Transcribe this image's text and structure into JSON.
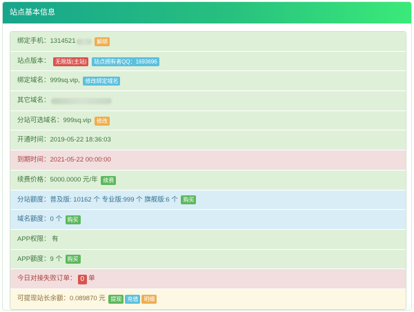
{
  "panel": {
    "title": "站点基本信息"
  },
  "rows": {
    "phone": {
      "label": "绑定手机：",
      "value": "1314521",
      "unbind": "解绑"
    },
    "version": {
      "label": "站点版本：",
      "edition": "无限版(主站)",
      "owner_qq": "站点拥有者QQ：1693696"
    },
    "domain": {
      "label": "绑定域名：",
      "value": "999sq.vip,",
      "modify": "修改绑定域名"
    },
    "other_domain": {
      "label": "其它域名："
    },
    "sub_domain": {
      "label": "分站可选域名：",
      "value": "999sq.vip",
      "modify": "修改"
    },
    "open_time": {
      "label": "开通时间：",
      "value": "2019-05-22 18:36:03"
    },
    "expire_time": {
      "label": "到期时间：",
      "value": "2021-05-22 00:00:00"
    },
    "renew_price": {
      "label": "续费价格：",
      "value": "5000.0000 元/年",
      "renew": "续费"
    },
    "quota": {
      "label": "分站额度：",
      "value": "普及版: 10162 个 专业版:999 个 旗舰版:6 个",
      "buy": "购买"
    },
    "domain_quota": {
      "label": "域名额度：",
      "value": "0 个",
      "buy": "购买"
    },
    "app_permission": {
      "label": "APP权限：",
      "value": "有"
    },
    "app_quota": {
      "label": "APP额度：",
      "value": "9 个",
      "buy": "购买"
    },
    "failed_orders": {
      "label": "今日对接失败订单：",
      "count": "0",
      "unit": "单"
    },
    "balance": {
      "label": "可提现站长余额：",
      "value": "0.089870 元",
      "withdraw": "提现",
      "recharge": "充值",
      "detail": "明细"
    }
  }
}
